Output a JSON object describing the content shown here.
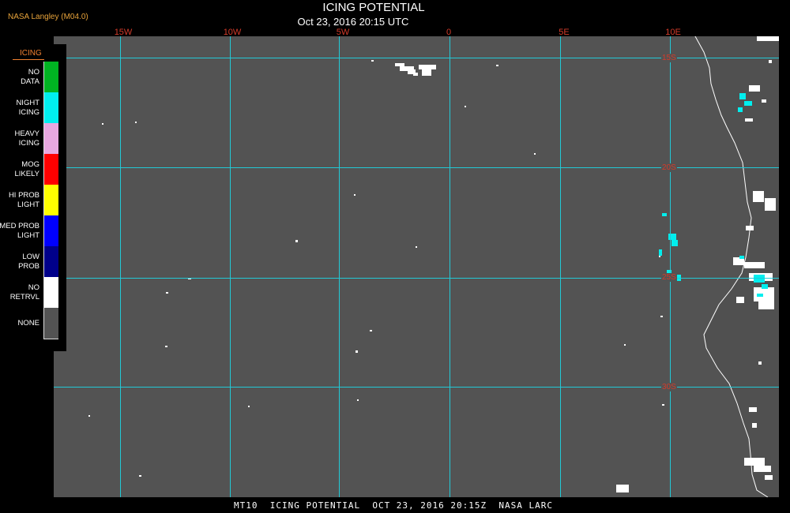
{
  "header": {
    "credit": "NASA Langley (M04.0)",
    "title": "ICING POTENTIAL",
    "datetime": "Oct 23, 2016 20:15 UTC"
  },
  "map": {
    "background_color": "#535353",
    "grid_color": "#22c9d6",
    "coast_color": "#ffffff",
    "longitude_labels": [
      "15W",
      "10W",
      "5W",
      "0",
      "5E",
      "10E"
    ],
    "latitude_labels": [
      "15S",
      "20S",
      "25S",
      "30S"
    ]
  },
  "legend": {
    "title": "ICING",
    "items": [
      {
        "label": "NO DATA",
        "color": "#00b422"
      },
      {
        "label": "NIGHT ICING",
        "color": "#00eeee"
      },
      {
        "label": "HEAVY ICING",
        "color": "#e8a8e0"
      },
      {
        "label": "MOG LIKELY",
        "color": "#ff0000"
      },
      {
        "label": "HI PROB LIGHT",
        "color": "#ffff00"
      },
      {
        "label": "MED PROB LIGHT",
        "color": "#0000ff"
      },
      {
        "label": "LOW PROB",
        "color": "#00008a"
      },
      {
        "label": "NO RETRVL",
        "color": "#ffffff"
      },
      {
        "label": "NONE",
        "color": "#535353"
      }
    ]
  },
  "footer": {
    "text": "MT10  ICING POTENTIAL  OCT 23, 2016 20:15Z  NASA LARC"
  }
}
